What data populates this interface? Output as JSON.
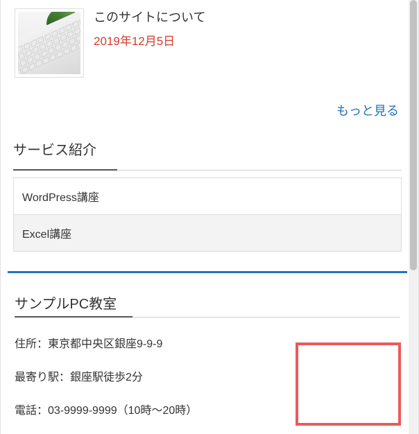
{
  "post": {
    "title": "このサイトについて",
    "date": "2019年12月5日"
  },
  "more_link": "もっと見る",
  "services": {
    "heading": "サービス紹介",
    "items": [
      {
        "label": "WordPress講座"
      },
      {
        "label": "Excel講座"
      }
    ]
  },
  "footer": {
    "heading": "サンプルPC教室",
    "address": "住所：東京都中央区銀座9-9-9",
    "station": "最寄り駅：銀座駅徒歩2分",
    "phone": "電話：03-9999-9999（10時〜20時）"
  }
}
